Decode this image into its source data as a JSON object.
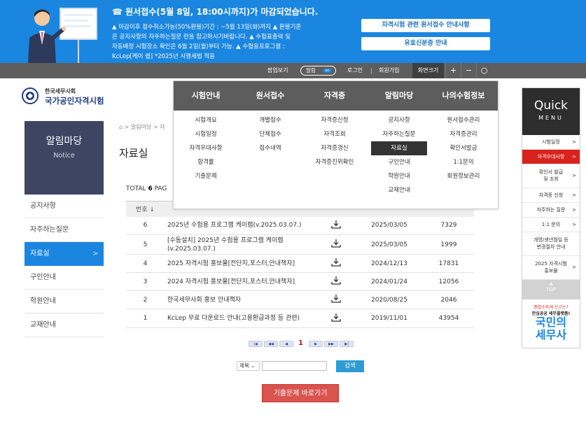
{
  "banner": {
    "title": "☎ 원서접수(5월 8일, 18:00시까지)가 마감되었습니다.",
    "lines": [
      "▲ 마감이후 접수취소가능(50%환불)기간 : ~5월 13일(화)까지 ▲ 환불기준",
      "은 공지사항의 자주하는질문 란을 참고하시기바랍니다. ▲ 수험표출력 및",
      "자동배정 시험장소 확인은 6월 2일(월)부터 가능. ▲ 수험용프로그램 :",
      "KcLep[케이 렙] *2025년 시행세법 적용"
    ],
    "btn1": "자격시험 관련 원서접수 안내사항",
    "btn2": "유효신분증 안내"
  },
  "topbar": {
    "popup": "팝업보기",
    "alarm": "알림",
    "alarm_toggle": "on",
    "login": "로그인",
    "join": "회원가입",
    "zoom": "화면크기",
    "plus": "+",
    "minus": "−",
    "reset": "○"
  },
  "logo": {
    "sub": "한국세무사회",
    "main": "국가공인자격시험"
  },
  "lnb": {
    "title": "알림마당",
    "subtitle": "Notice",
    "items": [
      "공지사항",
      "자주하는질문",
      "자료실",
      "구인안내",
      "학원안내",
      "교재안내"
    ],
    "arrow": ">"
  },
  "breadcrumb": "> 알림마당 > 자",
  "page_title": "자료실",
  "total": {
    "label": "TOTAL",
    "count": "6",
    "page_label": "PAG"
  },
  "table": {
    "headers": [
      "번호 ↓",
      "",
      "",
      "",
      ""
    ],
    "rows": [
      {
        "no": "6",
        "title": "2025년 수험용 프로그램 케이렙(v.2025.03.07.)",
        "date": "2025/03/05",
        "views": "7329"
      },
      {
        "no": "5",
        "title": "[수동설치] 2025년 수험용 프로그램 케이렙(v.2025.03.07.)",
        "date": "2025/03/05",
        "views": "1999"
      },
      {
        "no": "4",
        "title": "2025 자격시험 홍보물[전단지,포스터,안내책자]",
        "date": "2024/12/13",
        "views": "17831"
      },
      {
        "no": "3",
        "title": "2024 자격시험 홍보물[전단지,포스터,안내책자]",
        "date": "2024/01/24",
        "views": "12056"
      },
      {
        "no": "2",
        "title": "한국세무사회 홍보 안내책자",
        "date": "2020/08/25",
        "views": "2046"
      },
      {
        "no": "1",
        "title": "KcLep 무료 다운로드 안내(고용환급과정 등 관련)",
        "date": "2019/11/01",
        "views": "43954"
      }
    ]
  },
  "paging": {
    "first": "|◀",
    "prev": "◀◀",
    "prev1": "◀",
    "current": "1",
    "next1": "▶",
    "next": "▶▶",
    "last": "▶|"
  },
  "search": {
    "select_value": "제목 ⌄",
    "button": "검색"
  },
  "exam_button": "기출문제 바로가기",
  "mega_menu": {
    "heads": [
      "시험안내",
      "원서접수",
      "자격증",
      "알림마당",
      "나의수험정보"
    ],
    "cols": [
      [
        "시험개요",
        "시험일정",
        "자격우대사항",
        "합격률",
        "기출문제"
      ],
      [
        "개별접수",
        "단체접수",
        "접수내역"
      ],
      [
        "자격증신청",
        "자격조회",
        "자격증갱신",
        "자격증진위확인"
      ],
      [
        "공지사항",
        "자주하는질문",
        "자료실",
        "구인안내",
        "학원안내",
        "교재안내"
      ],
      [
        "원서접수관리",
        "자격증관리",
        "확인서발급",
        "1:1문의",
        "회원정보관리"
      ]
    ]
  },
  "quick": {
    "title": "Quick",
    "subtitle": "MENU",
    "items": [
      {
        "label": "시험일정",
        "arrow": ">"
      },
      {
        "label": "자격우대사항",
        "arrow": ">"
      },
      {
        "label1": "확인서 발급",
        "label2": "및 조회",
        "arrow": ">"
      },
      {
        "label": "자격증 신청",
        "arrow": ">"
      },
      {
        "label": "자주하는 질문",
        "arrow": ">"
      },
      {
        "label": "1:1 문의",
        "arrow": ">"
      },
      {
        "label1": "개명/생년월일 등",
        "label2": "변경절차 안내",
        "arrow": ""
      },
      {
        "label1": "2025 자격시험",
        "label2": "홍보물",
        "arrow": ">"
      }
    ],
    "top": "TOP",
    "ad1": "종합소득세 신고는?",
    "ad2": "안심공공 세무플랫폼!",
    "ad3": "국민의",
    "ad4": "세무사"
  },
  "colors": {
    "accent": "#1a86e0",
    "dark": "#5e5e5e",
    "active_red": "#d9221c"
  }
}
